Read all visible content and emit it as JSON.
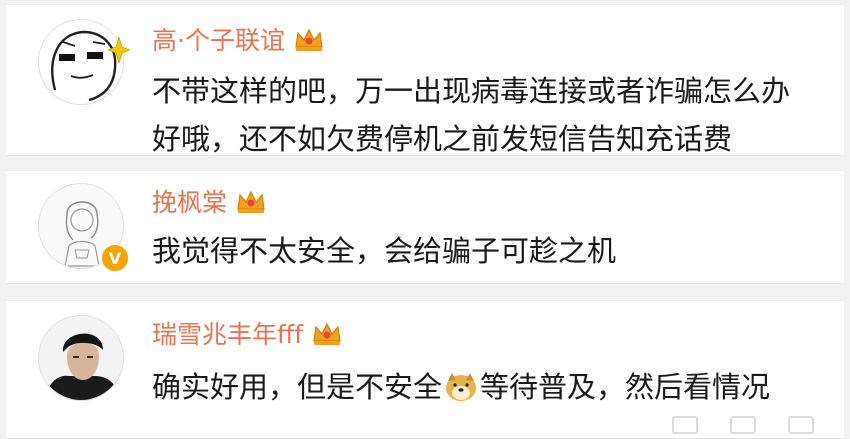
{
  "comments": [
    {
      "username": "高·个子联谊",
      "text_lines": [
        "不带这样的吧，万一出现病毒连接或者诈骗怎么办",
        "好哦，还不如欠费停机之前发短信告知充话费"
      ],
      "avatar": "meme-face-avatar",
      "badge": "crown-icon"
    },
    {
      "username": "挽枫棠",
      "text_lines": [
        "我觉得不太安全，会给骗子可趁之机"
      ],
      "avatar": "sketch-girl-avatar",
      "verified": "V",
      "badge": "crown-icon"
    },
    {
      "username": "瑞雪兆丰年fff",
      "text_before": "确实好用，但是不安全",
      "emoji": "doge-emoji",
      "text_after": "等待普及，然后看情况",
      "avatar": "man-photo-avatar",
      "badge": "crown-icon"
    }
  ],
  "colors": {
    "username": "#eb7350",
    "text": "#1a1a1a",
    "background": "#f2f2f2",
    "verified_badge": "#f7a400",
    "crown": "#f0a020"
  }
}
